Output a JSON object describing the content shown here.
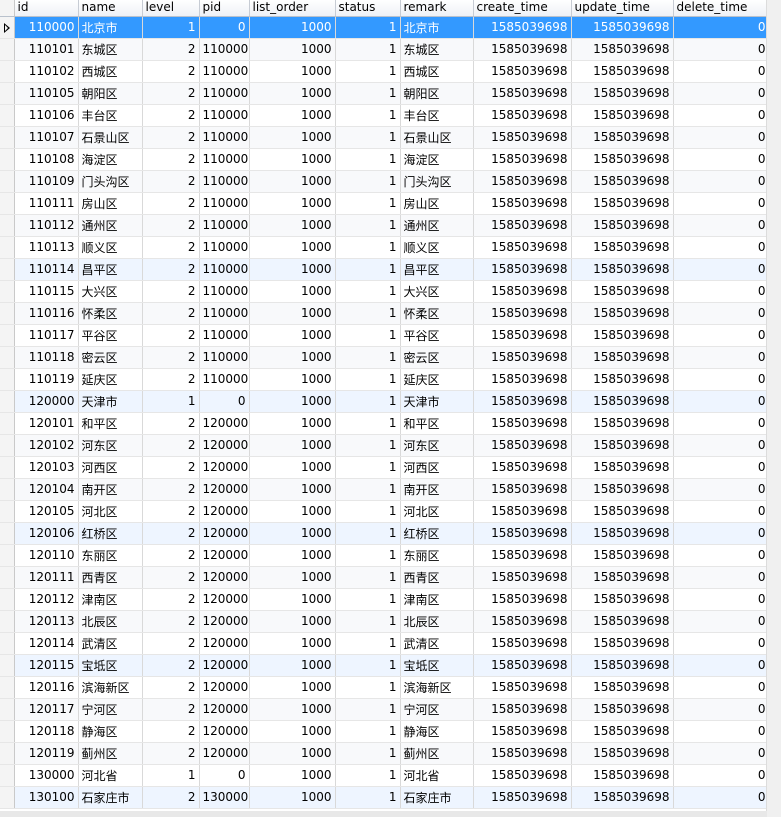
{
  "columns": [
    "id",
    "name",
    "level",
    "pid",
    "list_order",
    "status",
    "remark",
    "create_time",
    "update_time",
    "delete_time"
  ],
  "rows": [
    [
      "110000",
      "北京市",
      "1",
      "0",
      "1000",
      "1",
      "北京市",
      "1585039698",
      "1585039698",
      "0"
    ],
    [
      "110101",
      "东城区",
      "2",
      "110000",
      "1000",
      "1",
      "东城区",
      "1585039698",
      "1585039698",
      "0"
    ],
    [
      "110102",
      "西城区",
      "2",
      "110000",
      "1000",
      "1",
      "西城区",
      "1585039698",
      "1585039698",
      "0"
    ],
    [
      "110105",
      "朝阳区",
      "2",
      "110000",
      "1000",
      "1",
      "朝阳区",
      "1585039698",
      "1585039698",
      "0"
    ],
    [
      "110106",
      "丰台区",
      "2",
      "110000",
      "1000",
      "1",
      "丰台区",
      "1585039698",
      "1585039698",
      "0"
    ],
    [
      "110107",
      "石景山区",
      "2",
      "110000",
      "1000",
      "1",
      "石景山区",
      "1585039698",
      "1585039698",
      "0"
    ],
    [
      "110108",
      "海淀区",
      "2",
      "110000",
      "1000",
      "1",
      "海淀区",
      "1585039698",
      "1585039698",
      "0"
    ],
    [
      "110109",
      "门头沟区",
      "2",
      "110000",
      "1000",
      "1",
      "门头沟区",
      "1585039698",
      "1585039698",
      "0"
    ],
    [
      "110111",
      "房山区",
      "2",
      "110000",
      "1000",
      "1",
      "房山区",
      "1585039698",
      "1585039698",
      "0"
    ],
    [
      "110112",
      "通州区",
      "2",
      "110000",
      "1000",
      "1",
      "通州区",
      "1585039698",
      "1585039698",
      "0"
    ],
    [
      "110113",
      "顺义区",
      "2",
      "110000",
      "1000",
      "1",
      "顺义区",
      "1585039698",
      "1585039698",
      "0"
    ],
    [
      "110114",
      "昌平区",
      "2",
      "110000",
      "1000",
      "1",
      "昌平区",
      "1585039698",
      "1585039698",
      "0"
    ],
    [
      "110115",
      "大兴区",
      "2",
      "110000",
      "1000",
      "1",
      "大兴区",
      "1585039698",
      "1585039698",
      "0"
    ],
    [
      "110116",
      "怀柔区",
      "2",
      "110000",
      "1000",
      "1",
      "怀柔区",
      "1585039698",
      "1585039698",
      "0"
    ],
    [
      "110117",
      "平谷区",
      "2",
      "110000",
      "1000",
      "1",
      "平谷区",
      "1585039698",
      "1585039698",
      "0"
    ],
    [
      "110118",
      "密云区",
      "2",
      "110000",
      "1000",
      "1",
      "密云区",
      "1585039698",
      "1585039698",
      "0"
    ],
    [
      "110119",
      "延庆区",
      "2",
      "110000",
      "1000",
      "1",
      "延庆区",
      "1585039698",
      "1585039698",
      "0"
    ],
    [
      "120000",
      "天津市",
      "1",
      "0",
      "1000",
      "1",
      "天津市",
      "1585039698",
      "1585039698",
      "0"
    ],
    [
      "120101",
      "和平区",
      "2",
      "120000",
      "1000",
      "1",
      "和平区",
      "1585039698",
      "1585039698",
      "0"
    ],
    [
      "120102",
      "河东区",
      "2",
      "120000",
      "1000",
      "1",
      "河东区",
      "1585039698",
      "1585039698",
      "0"
    ],
    [
      "120103",
      "河西区",
      "2",
      "120000",
      "1000",
      "1",
      "河西区",
      "1585039698",
      "1585039698",
      "0"
    ],
    [
      "120104",
      "南开区",
      "2",
      "120000",
      "1000",
      "1",
      "南开区",
      "1585039698",
      "1585039698",
      "0"
    ],
    [
      "120105",
      "河北区",
      "2",
      "120000",
      "1000",
      "1",
      "河北区",
      "1585039698",
      "1585039698",
      "0"
    ],
    [
      "120106",
      "红桥区",
      "2",
      "120000",
      "1000",
      "1",
      "红桥区",
      "1585039698",
      "1585039698",
      "0"
    ],
    [
      "120110",
      "东丽区",
      "2",
      "120000",
      "1000",
      "1",
      "东丽区",
      "1585039698",
      "1585039698",
      "0"
    ],
    [
      "120111",
      "西青区",
      "2",
      "120000",
      "1000",
      "1",
      "西青区",
      "1585039698",
      "1585039698",
      "0"
    ],
    [
      "120112",
      "津南区",
      "2",
      "120000",
      "1000",
      "1",
      "津南区",
      "1585039698",
      "1585039698",
      "0"
    ],
    [
      "120113",
      "北辰区",
      "2",
      "120000",
      "1000",
      "1",
      "北辰区",
      "1585039698",
      "1585039698",
      "0"
    ],
    [
      "120114",
      "武清区",
      "2",
      "120000",
      "1000",
      "1",
      "武清区",
      "1585039698",
      "1585039698",
      "0"
    ],
    [
      "120115",
      "宝坻区",
      "2",
      "120000",
      "1000",
      "1",
      "宝坻区",
      "1585039698",
      "1585039698",
      "0"
    ],
    [
      "120116",
      "滨海新区",
      "2",
      "120000",
      "1000",
      "1",
      "滨海新区",
      "1585039698",
      "1585039698",
      "0"
    ],
    [
      "120117",
      "宁河区",
      "2",
      "120000",
      "1000",
      "1",
      "宁河区",
      "1585039698",
      "1585039698",
      "0"
    ],
    [
      "120118",
      "静海区",
      "2",
      "120000",
      "1000",
      "1",
      "静海区",
      "1585039698",
      "1585039698",
      "0"
    ],
    [
      "120119",
      "蓟州区",
      "2",
      "120000",
      "1000",
      "1",
      "蓟州区",
      "1585039698",
      "1585039698",
      "0"
    ],
    [
      "130000",
      "河北省",
      "1",
      "0",
      "1000",
      "1",
      "河北省",
      "1585039698",
      "1585039698",
      "0"
    ],
    [
      "130100",
      "石家庄市",
      "2",
      "130000",
      "1000",
      "1",
      "石家庄市",
      "1585039698",
      "1585039698",
      "0"
    ]
  ],
  "selected_row": 0,
  "highlight_color": "#3399ff"
}
